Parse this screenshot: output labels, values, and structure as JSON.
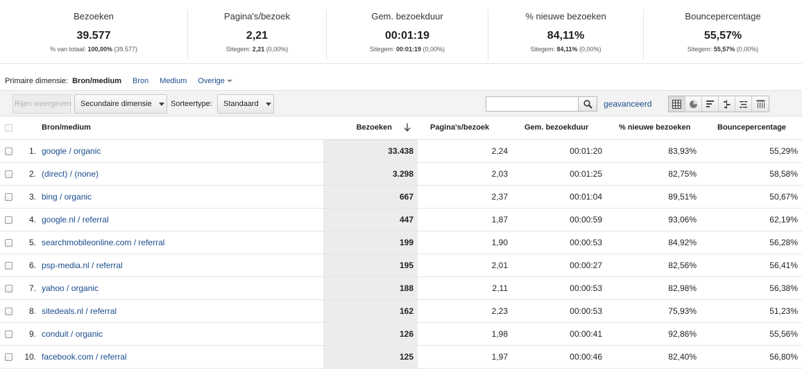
{
  "scorecards": [
    {
      "label": "Bezoeken",
      "value": "39.577",
      "sub_prefix": "% van totaal: ",
      "sub_bold": "100,00%",
      "sub_suffix": " (39.577)"
    },
    {
      "label": "Pagina's/bezoek",
      "value": "2,21",
      "sub_prefix": "Sitegem: ",
      "sub_bold": "2,21",
      "sub_suffix": " (0,00%)"
    },
    {
      "label": "Gem. bezoekduur",
      "value": "00:01:19",
      "sub_prefix": "Sitegem: ",
      "sub_bold": "00:01:19",
      "sub_suffix": " (0,00%)"
    },
    {
      "label": "% nieuwe bezoeken",
      "value": "84,11%",
      "sub_prefix": "Sitegem: ",
      "sub_bold": "84,11%",
      "sub_suffix": " (0,00%)"
    },
    {
      "label": "Bouncepercentage",
      "value": "55,57%",
      "sub_prefix": "Sitegem: ",
      "sub_bold": "55,57%",
      "sub_suffix": " (0,00%)"
    }
  ],
  "dimension_bar": {
    "label": "Primaire dimensie:",
    "active": "Bron/medium",
    "links": [
      "Bron",
      "Medium"
    ],
    "other": "Overige"
  },
  "toolbar": {
    "plot_rows": "Rijen weergeven",
    "secondary_dimension": "Secundaire dimensie",
    "sort_label": "Sorteertype:",
    "sort_value": "Standaard",
    "search_value": "",
    "advanced": "geavanceerd"
  },
  "table": {
    "headers": {
      "dimension": "Bron/medium",
      "visits": "Bezoeken",
      "pages": "Pagina's/bezoek",
      "duration": "Gem. bezoekduur",
      "new": "% nieuwe bezoeken",
      "bounce": "Bouncepercentage"
    },
    "rows": [
      {
        "idx": "1.",
        "dim": "google / organic",
        "visits": "33.438",
        "pages": "2,24",
        "duration": "00:01:20",
        "new": "83,93%",
        "bounce": "55,29%"
      },
      {
        "idx": "2.",
        "dim": "(direct) / (none)",
        "visits": "3.298",
        "pages": "2,03",
        "duration": "00:01:25",
        "new": "82,75%",
        "bounce": "58,58%"
      },
      {
        "idx": "3.",
        "dim": "bing / organic",
        "visits": "667",
        "pages": "2,37",
        "duration": "00:01:04",
        "new": "89,51%",
        "bounce": "50,67%"
      },
      {
        "idx": "4.",
        "dim": "google.nl / referral",
        "visits": "447",
        "pages": "1,87",
        "duration": "00:00:59",
        "new": "93,06%",
        "bounce": "62,19%"
      },
      {
        "idx": "5.",
        "dim": "searchmobileonline.com / referral",
        "visits": "199",
        "pages": "1,90",
        "duration": "00:00:53",
        "new": "84,92%",
        "bounce": "56,28%"
      },
      {
        "idx": "6.",
        "dim": "psp-media.nl / referral",
        "visits": "195",
        "pages": "2,01",
        "duration": "00:00:27",
        "new": "82,56%",
        "bounce": "56,41%"
      },
      {
        "idx": "7.",
        "dim": "yahoo / organic",
        "visits": "188",
        "pages": "2,11",
        "duration": "00:00:53",
        "new": "82,98%",
        "bounce": "56,38%"
      },
      {
        "idx": "8.",
        "dim": "sitedeals.nl / referral",
        "visits": "162",
        "pages": "2,23",
        "duration": "00:00:53",
        "new": "75,93%",
        "bounce": "51,23%"
      },
      {
        "idx": "9.",
        "dim": "conduit / organic",
        "visits": "126",
        "pages": "1,98",
        "duration": "00:00:41",
        "new": "92,86%",
        "bounce": "55,56%"
      },
      {
        "idx": "10.",
        "dim": "facebook.com / referral",
        "visits": "125",
        "pages": "1,97",
        "duration": "00:00:46",
        "new": "82,40%",
        "bounce": "56,80%"
      }
    ]
  },
  "colors": {
    "link": "#1a4c8d",
    "highlight_column": "#ececec"
  },
  "icons": [
    "search-icon",
    "table-view-icon",
    "pie-view-icon",
    "bar-view-icon",
    "comparison-view-icon",
    "term-cloud-view-icon",
    "pivot-view-icon",
    "sort-down-icon",
    "chevron-down-icon"
  ]
}
